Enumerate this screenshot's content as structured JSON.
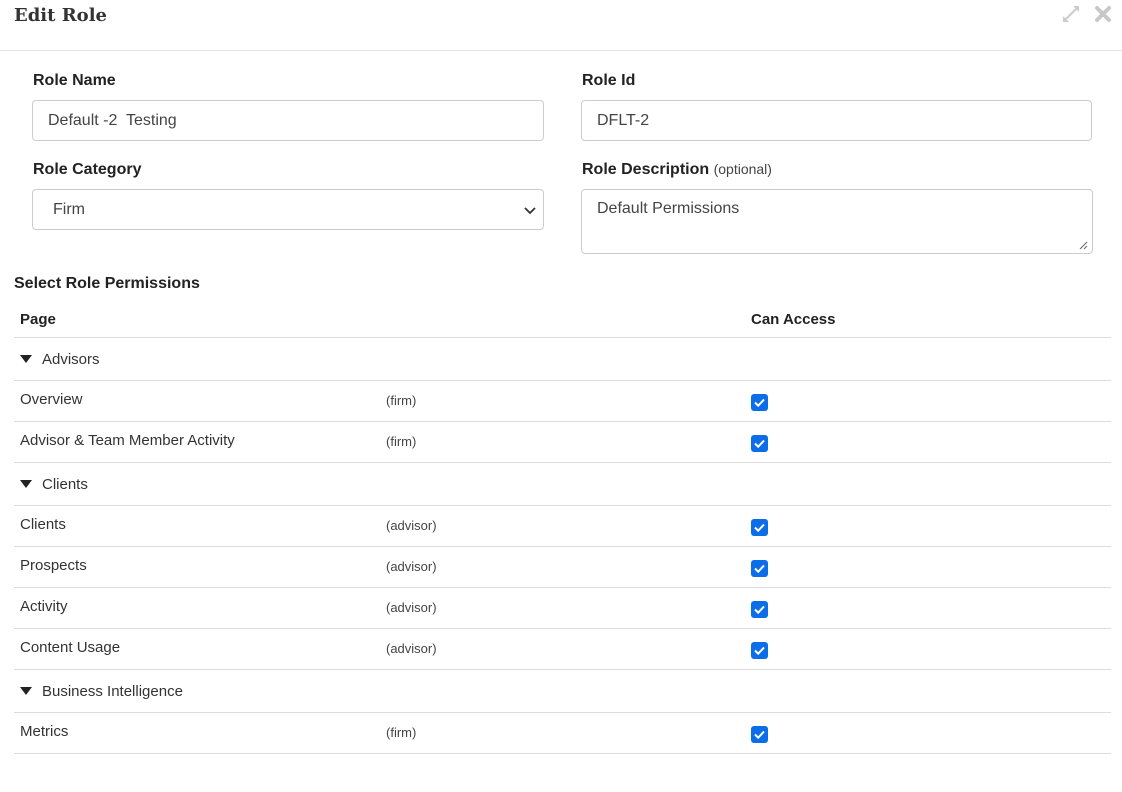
{
  "dialog": {
    "title": "Edit Role",
    "icons": [
      "expand-icon",
      "close-icon"
    ]
  },
  "form": {
    "role_name": {
      "label": "Role Name",
      "value": "Default -2  Testing"
    },
    "role_id": {
      "label": "Role Id",
      "value": "DFLT-2"
    },
    "role_category": {
      "label": "Role Category",
      "value": "Firm"
    },
    "role_description": {
      "label": "Role Description",
      "optional": "(optional)",
      "value": "Default Permissions"
    }
  },
  "permissions": {
    "title": "Select Role Permissions",
    "col_page": "Page",
    "col_access": "Can Access",
    "groups": [
      {
        "name": "Advisors",
        "items": [
          {
            "label": "Overview",
            "scope": "(firm)",
            "checked": true
          },
          {
            "label": "Advisor & Team Member Activity",
            "scope": "(firm)",
            "checked": true
          }
        ]
      },
      {
        "name": "Clients",
        "items": [
          {
            "label": "Clients",
            "scope": "(advisor)",
            "checked": true
          },
          {
            "label": "Prospects",
            "scope": "(advisor)",
            "checked": true
          },
          {
            "label": "Activity",
            "scope": "(advisor)",
            "checked": true
          },
          {
            "label": "Content Usage",
            "scope": "(advisor)",
            "checked": true
          }
        ]
      },
      {
        "name": "Business Intelligence",
        "items": [
          {
            "label": "Metrics",
            "scope": "(firm)",
            "checked": true
          }
        ]
      }
    ]
  },
  "colors": {
    "accent": "#0b6ee8",
    "border": "#cccccc",
    "divider": "#dddddd"
  }
}
